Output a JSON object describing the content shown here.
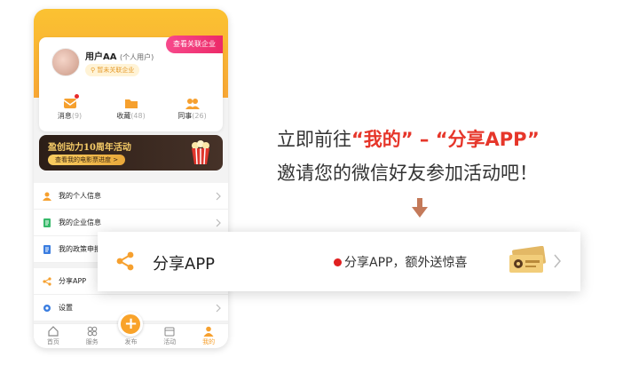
{
  "profile": {
    "link_company_button": "查看关联企业",
    "username": "用户AA",
    "role": "(个人用户)",
    "company_tag": "暂未关联企业"
  },
  "stats": [
    {
      "label": "消息",
      "count": "(9)",
      "icon": "message-icon"
    },
    {
      "label": "收藏",
      "count": "(48)",
      "icon": "folder-icon"
    },
    {
      "label": "同事",
      "count": "(26)",
      "icon": "colleague-icon"
    }
  ],
  "banner": {
    "title": "盈创动力10周年活动",
    "button": "查看我的电影票进度 >"
  },
  "menu": {
    "personal_info": "我的个人信息",
    "company_info": "我的企业信息",
    "policy": "我的政策申报",
    "share": "分享APP",
    "settings": "设置"
  },
  "tabs": [
    {
      "label": "首页",
      "icon": "home-icon"
    },
    {
      "label": "服务",
      "icon": "service-icon"
    },
    {
      "label": "发布",
      "icon": "publish-icon"
    },
    {
      "label": "活动",
      "icon": "activity-icon"
    },
    {
      "label": "我的",
      "icon": "profile-icon"
    }
  ],
  "headline": {
    "prefix": "立即前往",
    "part1": "“我的”",
    "dash": " – ",
    "part2": "“分享APP”"
  },
  "subline": "邀请您的微信好友参加活动吧！",
  "share_row": {
    "title": "分享APP",
    "hint": "分享APP，额外送惊喜"
  },
  "colors": {
    "accent": "#f8a735",
    "highlight": "#e6362a",
    "pink": "#ec2a68"
  }
}
